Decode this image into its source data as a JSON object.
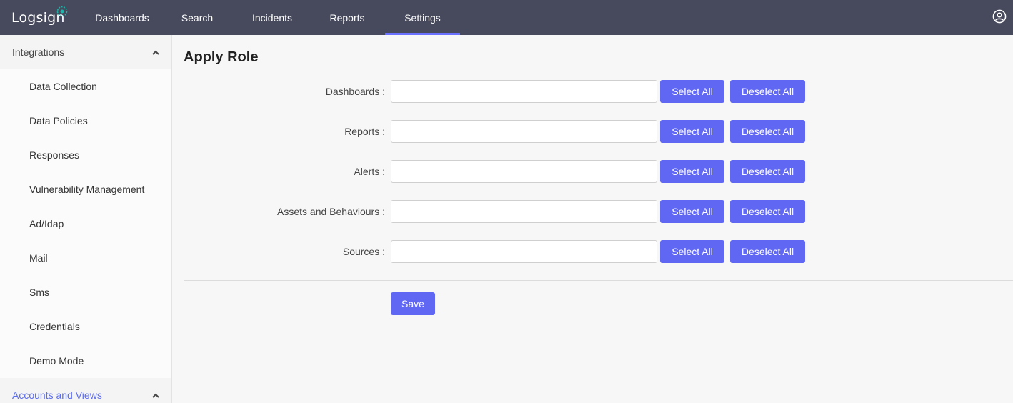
{
  "app": {
    "logo_text": "Logsign"
  },
  "nav": {
    "items": [
      {
        "label": "Dashboards"
      },
      {
        "label": "Search"
      },
      {
        "label": "Incidents"
      },
      {
        "label": "Reports"
      },
      {
        "label": "Settings"
      }
    ],
    "active": "Settings"
  },
  "sidebar": {
    "integrations": {
      "title": "Integrations",
      "items": [
        {
          "label": "Data Collection"
        },
        {
          "label": "Data Policies"
        },
        {
          "label": "Responses"
        },
        {
          "label": "Vulnerability Management"
        },
        {
          "label": "Ad/Idap"
        },
        {
          "label": "Mail"
        },
        {
          "label": "Sms"
        },
        {
          "label": "Credentials"
        },
        {
          "label": "Demo Mode"
        }
      ]
    },
    "accounts": {
      "title": "Accounts and Views"
    }
  },
  "main": {
    "title": "Apply Role",
    "rows": [
      {
        "label": "Dashboards :",
        "value": ""
      },
      {
        "label": "Reports :",
        "value": ""
      },
      {
        "label": "Alerts :",
        "value": ""
      },
      {
        "label": "Assets and Behaviours :",
        "value": ""
      },
      {
        "label": "Sources :",
        "value": ""
      }
    ],
    "select_all_label": "Select All",
    "deselect_all_label": "Deselect All",
    "save_label": "Save"
  },
  "colors": {
    "topbar": "#474a5d",
    "accent": "#6067f2",
    "active_link": "#5b6cf0"
  }
}
